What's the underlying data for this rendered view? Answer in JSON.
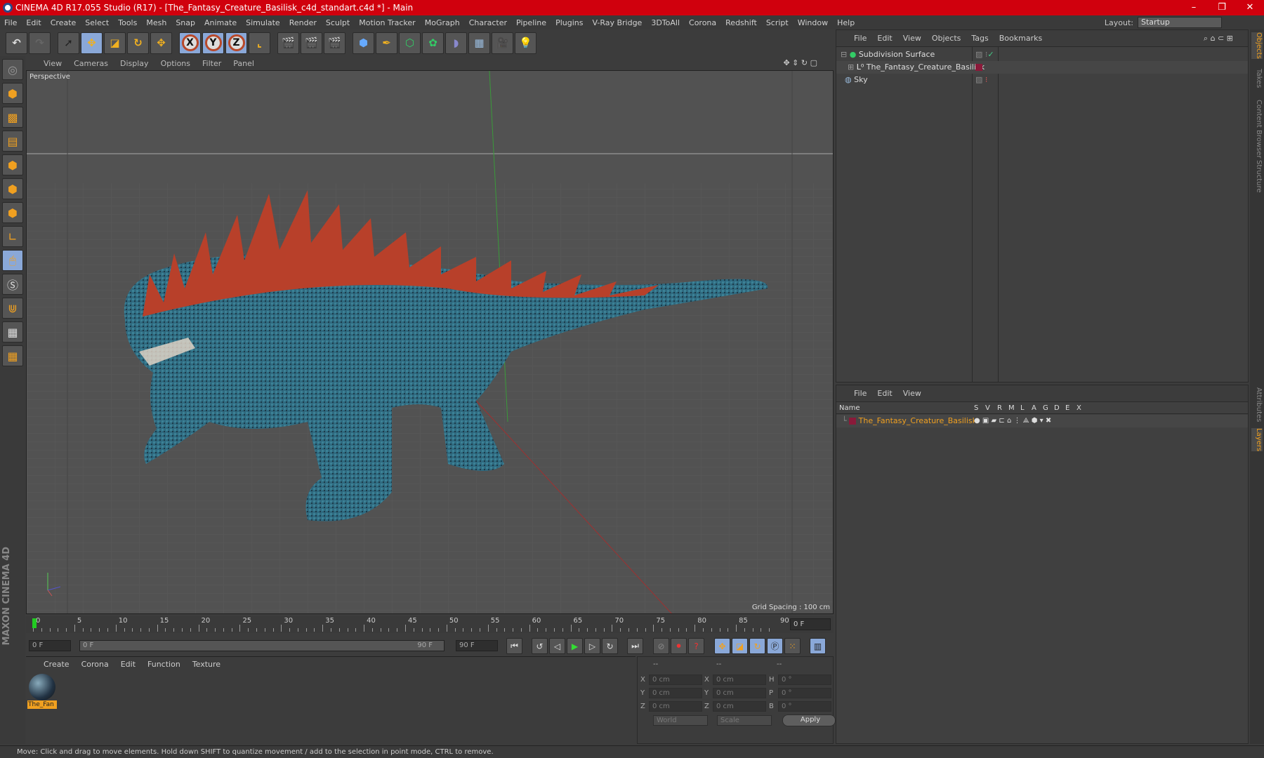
{
  "title": "CINEMA 4D R17.055 Studio (R17) - [The_Fantasy_Creature_Basilisk_c4d_standart.c4d *] - Main",
  "menu": [
    "File",
    "Edit",
    "Create",
    "Select",
    "Tools",
    "Mesh",
    "Snap",
    "Animate",
    "Simulate",
    "Render",
    "Sculpt",
    "Motion Tracker",
    "MoGraph",
    "Character",
    "Pipeline",
    "Plugins",
    "V-Ray Bridge",
    "3DToAll",
    "Corona",
    "Redshift",
    "Script",
    "Window",
    "Help"
  ],
  "layout": {
    "label": "Layout:",
    "value": "Startup"
  },
  "toolbar": {
    "axes": [
      "X",
      "Y",
      "Z"
    ]
  },
  "viewport": {
    "menu": [
      "View",
      "Cameras",
      "Display",
      "Options",
      "Filter",
      "Panel"
    ],
    "label": "Perspective",
    "grid_spacing": "Grid Spacing : 100 cm"
  },
  "timeline": {
    "ticks": [
      "0",
      "5",
      "10",
      "15",
      "20",
      "25",
      "30",
      "35",
      "40",
      "45",
      "50",
      "55",
      "60",
      "65",
      "70",
      "75",
      "80",
      "85",
      "90"
    ],
    "current": "0 F"
  },
  "controls": {
    "start": "0 F",
    "range_start": "0 F",
    "range_end": "90 F",
    "end": "90 F"
  },
  "materials": {
    "menu": [
      "Create",
      "Corona",
      "Edit",
      "Function",
      "Texture"
    ],
    "items": [
      {
        "name": "The_Fan"
      }
    ]
  },
  "coords": {
    "headers": [
      "--",
      "--",
      "--"
    ],
    "rows": [
      {
        "a": "X",
        "av": "0 cm",
        "b": "X",
        "bv": "0 cm",
        "c": "H",
        "cv": "0 °"
      },
      {
        "a": "Y",
        "av": "0 cm",
        "b": "Y",
        "bv": "0 cm",
        "c": "P",
        "cv": "0 °"
      },
      {
        "a": "Z",
        "av": "0 cm",
        "b": "Z",
        "bv": "0 cm",
        "c": "B",
        "cv": "0 °"
      }
    ],
    "mode": "World",
    "type": "Scale",
    "apply": "Apply"
  },
  "objects": {
    "menu": [
      "File",
      "Edit",
      "View",
      "Objects",
      "Tags",
      "Bookmarks"
    ],
    "items": [
      "Subdivision Surface",
      "The_Fantasy_Creature_Basilisk",
      "Sky"
    ]
  },
  "layers": {
    "menu": [
      "File",
      "Edit",
      "View"
    ],
    "columns": [
      "Name",
      "S",
      "V",
      "R",
      "M",
      "L",
      "A",
      "G",
      "D",
      "E",
      "X"
    ],
    "items": [
      {
        "name": "The_Fantasy_Creature_Basilisk",
        "color": "#8a1a3a"
      }
    ]
  },
  "right_tabs": [
    "Objects",
    "Takes",
    "Content Browser",
    "Structure",
    "Attributes",
    "Layers"
  ],
  "branding": "MAXON CINEMA 4D",
  "status": "Move: Click and drag to move elements. Hold down SHIFT to quantize movement / add to the selection in point mode, CTRL to remove."
}
